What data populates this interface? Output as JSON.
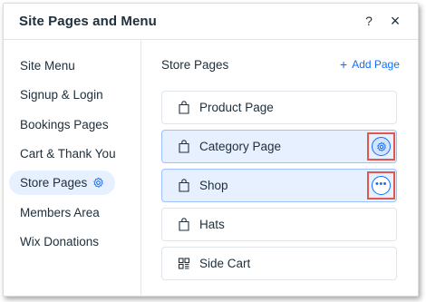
{
  "dialog": {
    "title": "Site Pages and Menu",
    "help_label": "?",
    "close_label": "×"
  },
  "sidebar": {
    "items": [
      {
        "label": "Site Menu"
      },
      {
        "label": "Signup & Login"
      },
      {
        "label": "Bookings Pages"
      },
      {
        "label": "Cart & Thank You"
      },
      {
        "label": "Store Pages",
        "active": true
      },
      {
        "label": "Members Area"
      },
      {
        "label": "Wix Donations"
      }
    ]
  },
  "main": {
    "section_title": "Store Pages",
    "add_page_label": "Add Page",
    "pages": [
      {
        "label": "Product Page",
        "icon": "shopping-bag-icon"
      },
      {
        "label": "Category Page",
        "icon": "shopping-bag-icon",
        "selected": true,
        "action": "settings"
      },
      {
        "label": "Shop",
        "icon": "shopping-bag-icon",
        "selected": true,
        "action": "more"
      },
      {
        "label": "Hats",
        "icon": "shopping-bag-icon"
      },
      {
        "label": "Side Cart",
        "icon": "side-cart-icon"
      }
    ]
  },
  "colors": {
    "accent": "#116dff",
    "selected_bg": "#e7f0ff",
    "highlight": "#e0574f"
  }
}
